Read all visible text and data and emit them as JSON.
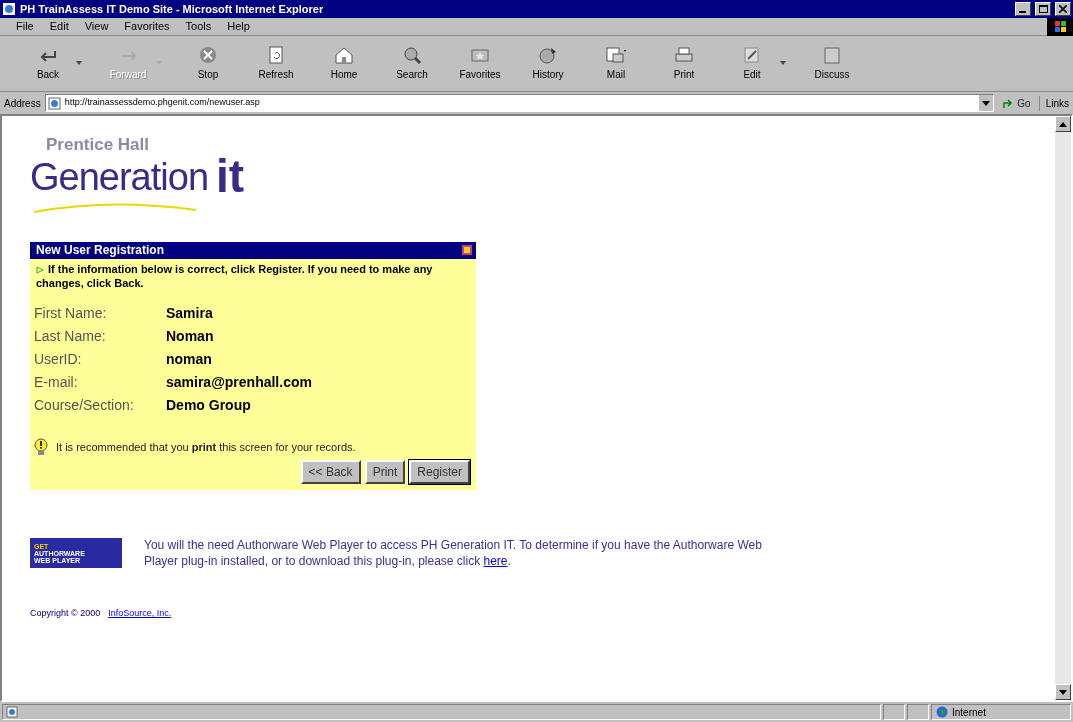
{
  "window": {
    "title": "PH TrainAssess IT Demo Site - Microsoft Internet Explorer"
  },
  "menu": [
    "File",
    "Edit",
    "View",
    "Favorites",
    "Tools",
    "Help"
  ],
  "toolbar": [
    {
      "kind": "back",
      "label": "Back",
      "disabled": false,
      "dropdown": true
    },
    {
      "kind": "forward",
      "label": "Forward",
      "disabled": true,
      "dropdown": true
    },
    {
      "kind": "stop",
      "label": "Stop",
      "disabled": false,
      "dropdown": false
    },
    {
      "kind": "refresh",
      "label": "Refresh",
      "disabled": false,
      "dropdown": false
    },
    {
      "kind": "home",
      "label": "Home",
      "disabled": false,
      "dropdown": false
    },
    {
      "kind": "search",
      "label": "Search",
      "disabled": false,
      "dropdown": false
    },
    {
      "kind": "favorites",
      "label": "Favorites",
      "disabled": false,
      "dropdown": false
    },
    {
      "kind": "history",
      "label": "History",
      "disabled": false,
      "dropdown": false
    },
    {
      "kind": "mail",
      "label": "Mail",
      "disabled": false,
      "dropdown": false
    },
    {
      "kind": "print",
      "label": "Print",
      "disabled": false,
      "dropdown": false
    },
    {
      "kind": "edit",
      "label": "Edit",
      "disabled": false,
      "dropdown": true
    },
    {
      "kind": "discuss",
      "label": "Discuss",
      "disabled": false,
      "dropdown": false
    }
  ],
  "address": {
    "label": "Address",
    "value": "http://trainassessdemo.phgenit.com/newuser.asp",
    "go": "Go",
    "links": "Links"
  },
  "logo": {
    "line1": "Prentice Hall",
    "line2": "Generation",
    "line3": "it"
  },
  "panel": {
    "title": "New User Registration",
    "instruction": "If the information below is correct, click Register.  If you need to make any changes, click Back.",
    "fields": [
      {
        "label": "First Name:",
        "value": "Samira"
      },
      {
        "label": "Last Name:",
        "value": "Noman"
      },
      {
        "label": "UserID:",
        "value": "noman"
      },
      {
        "label": "E-mail:",
        "value": "samira@prenhall.com"
      },
      {
        "label": "Course/Section:",
        "value": "Demo Group"
      }
    ],
    "tip": "It is recommended that you **print** this screen for your records.",
    "buttons": [
      "<< Back",
      "Print",
      "Register"
    ]
  },
  "plugin": {
    "badge_top": "GET",
    "badge_mid": "AUTHORWARE",
    "badge_bottom": "WEB PLAYER",
    "text": "You will the need Authorware Web Player to access PH Generation IT.  To determine if you have the Authorware Web Player plug-in installed, or to download this plug-in, please click ",
    "link": "here",
    "after": "."
  },
  "copyright": {
    "text": "Copyright © 2000",
    "link": "InfoSource, Inc."
  },
  "status": {
    "zone": "Internet"
  }
}
